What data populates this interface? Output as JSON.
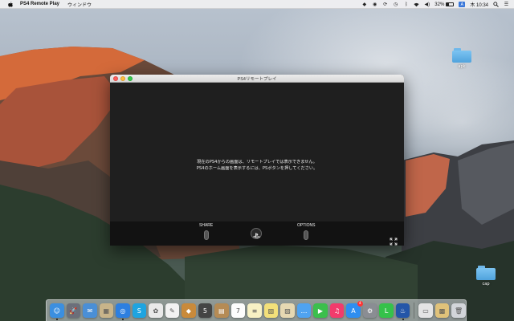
{
  "menubar": {
    "app_name": "PS4 Remote Play",
    "menus": [
      "ウィンドウ"
    ],
    "battery_percent": "32%",
    "input_badge": "A",
    "clock": "木 10:34"
  },
  "desktop": {
    "folders": [
      {
        "label": "apk",
        "icon": "folder-icon"
      },
      {
        "label": "cap",
        "icon": "folder-icon"
      }
    ]
  },
  "window": {
    "title": "PS4リモートプレイ",
    "message_line1": "現在のPS4からの画面は、リモートプレイでは表示できません。",
    "message_line2": "PS4のホーム画面を表示するには、PSボタンを押してください。",
    "share_label": "SHARE",
    "options_label": "OPTIONS"
  },
  "dock": {
    "items": [
      {
        "name": "finder",
        "glyph": "☺",
        "color": "#3b8fe0",
        "running": true
      },
      {
        "name": "launchpad",
        "glyph": "🚀",
        "color": "#6b6f7a"
      },
      {
        "name": "mail-app",
        "glyph": "✉",
        "color": "#4a8fd6"
      },
      {
        "name": "preview",
        "glyph": "▦",
        "color": "#c8b48a"
      },
      {
        "name": "safari",
        "glyph": "◎",
        "color": "#2d7fe0",
        "running": true
      },
      {
        "name": "skype",
        "glyph": "S",
        "color": "#1ea4e0"
      },
      {
        "name": "photos",
        "glyph": "✿",
        "color": "#e9e9e9"
      },
      {
        "name": "pencil-app",
        "glyph": "✎",
        "color": "#f2f2f2"
      },
      {
        "name": "pixelmator",
        "glyph": "◆",
        "color": "#c98a3b"
      },
      {
        "name": "books-app",
        "glyph": "5",
        "color": "#444"
      },
      {
        "name": "contacts",
        "glyph": "▤",
        "color": "#b58b55"
      },
      {
        "name": "calendar",
        "glyph": "7",
        "color": "#fdfdfd"
      },
      {
        "name": "notes",
        "glyph": "≡",
        "color": "#f7f1c4"
      },
      {
        "name": "stickies",
        "glyph": "▧",
        "color": "#f3e07a"
      },
      {
        "name": "preview-2",
        "glyph": "▨",
        "color": "#e6d8b2"
      },
      {
        "name": "messages",
        "glyph": "…",
        "color": "#4fa3f0"
      },
      {
        "name": "facetime",
        "glyph": "▶",
        "color": "#3bbf4c"
      },
      {
        "name": "itunes",
        "glyph": "♫",
        "color": "#f23b6c"
      },
      {
        "name": "app-store",
        "glyph": "A",
        "color": "#2f8ef0",
        "badge": "4"
      },
      {
        "name": "system-preferences",
        "glyph": "⚙",
        "color": "#8a8d93"
      },
      {
        "name": "line-app",
        "glyph": "L",
        "color": "#35c24a"
      },
      {
        "name": "ps4-remote-play",
        "glyph": "♨",
        "color": "#2456a8",
        "running": true
      }
    ],
    "right_items": [
      {
        "name": "documents-stack",
        "glyph": "▭",
        "color": "#e4e4e4"
      },
      {
        "name": "downloads-stack",
        "glyph": "▩",
        "color": "#e0c27a"
      },
      {
        "name": "trash",
        "glyph": "🗑",
        "color": "#d2d5da"
      }
    ]
  }
}
